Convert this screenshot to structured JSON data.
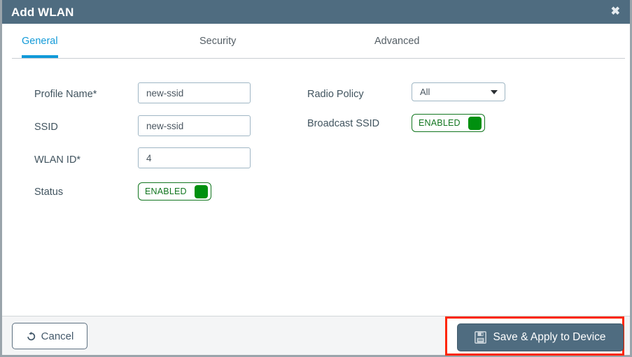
{
  "dialog": {
    "title": "Add WLAN",
    "close_icon": "close-icon"
  },
  "tabs": [
    {
      "label": "General",
      "active": true
    },
    {
      "label": "Security",
      "active": false
    },
    {
      "label": "Advanced",
      "active": false
    }
  ],
  "form": {
    "profile_name": {
      "label": "Profile Name*",
      "value": "new-ssid",
      "placeholder": ""
    },
    "ssid": {
      "label": "SSID",
      "value": "new-ssid",
      "placeholder": ""
    },
    "wlan_id": {
      "label": "WLAN ID*",
      "value": "4",
      "placeholder": ""
    },
    "status": {
      "label": "Status",
      "toggle_text": "ENABLED",
      "enabled": true
    },
    "radio_policy": {
      "label": "Radio Policy",
      "value": "All"
    },
    "broadcast_ssid": {
      "label": "Broadcast SSID",
      "toggle_text": "ENABLED",
      "enabled": true
    }
  },
  "footer": {
    "cancel_label": "Cancel",
    "cancel_icon": "undo-icon",
    "save_label": "Save & Apply to Device",
    "save_icon": "floppy-save-icon"
  },
  "colors": {
    "titlebar": "#4f6c80",
    "accent_tab": "#109ad9",
    "toggle_green": "#00900f",
    "toggle_border_green": "#12761f",
    "primary_button": "#4f6c80",
    "highlight_red": "#fe2600",
    "footer_bg": "#f4f5f6",
    "label_text": "#41545f"
  }
}
